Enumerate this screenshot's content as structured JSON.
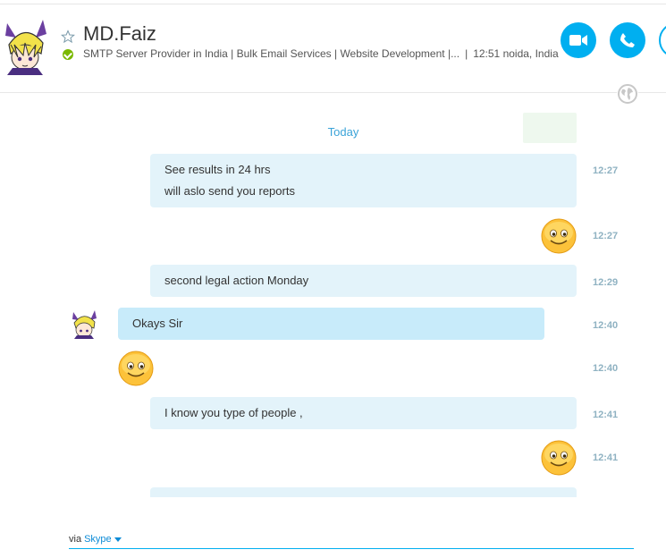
{
  "contact": {
    "name": "MD.Faiz",
    "mood": "SMTP Server Provider in India | Bulk Email Services | Website Development |...",
    "local_time": "12:51 noida, India"
  },
  "colors": {
    "accent": "#00aff0",
    "online": "#7ab800",
    "bubble_out": "#e3f3fa",
    "bubble_in": "#c8ebfa",
    "time_text": "#8fb2c2",
    "day_label": "#3aa3d8"
  },
  "conversation": {
    "day_label": "Today",
    "messages": [
      {
        "direction": "out",
        "lines": [
          "See results in 24 hrs",
          "will aslo send you reports"
        ],
        "time": "12:27"
      },
      {
        "direction": "out",
        "emoticon": "smile-emoticon",
        "time": "12:27"
      },
      {
        "direction": "out",
        "lines": [
          "second legal action Monday"
        ],
        "time": "12:29"
      },
      {
        "direction": "in",
        "lines": [
          "Okays Sir"
        ],
        "time": "12:40"
      },
      {
        "direction": "in",
        "emoticon": "smile-emoticon",
        "time": "12:40"
      },
      {
        "direction": "out",
        "lines": [
          "I know you type of people ,"
        ],
        "time": "12:41"
      },
      {
        "direction": "out",
        "emoticon": "smile-emoticon",
        "time": "12:41"
      }
    ]
  },
  "composer": {
    "via_label": "via",
    "via_service": "Skype"
  }
}
